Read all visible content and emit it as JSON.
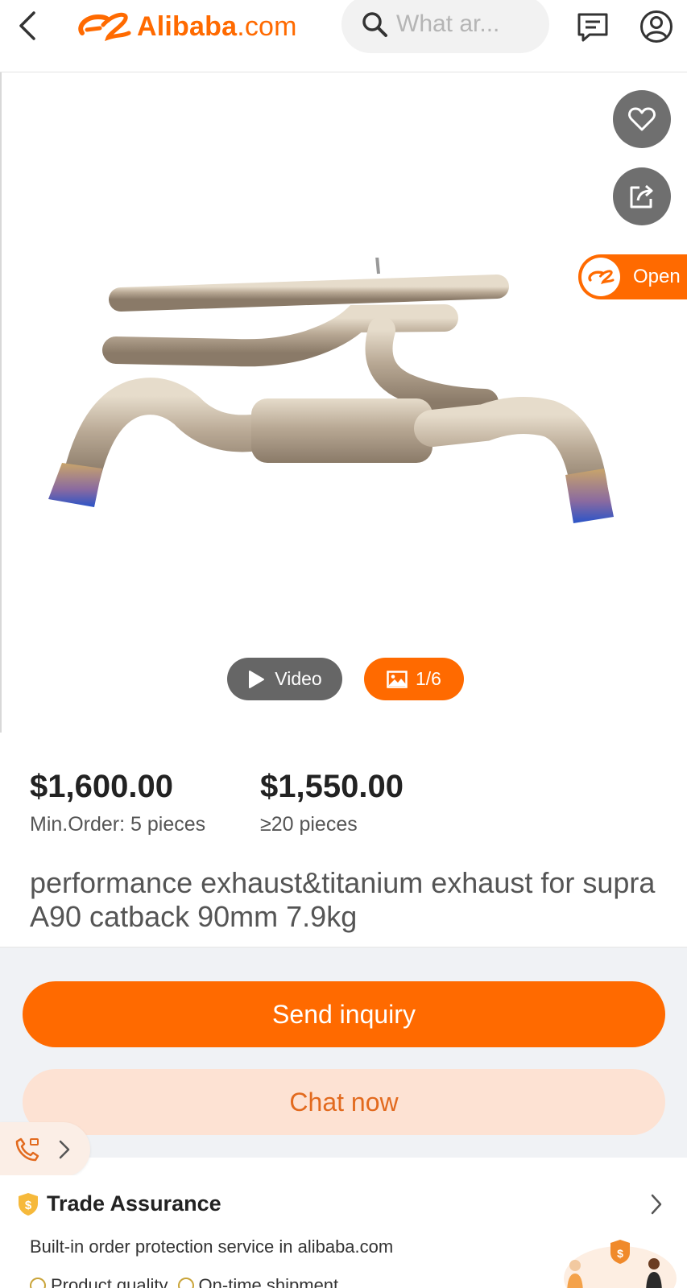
{
  "header": {
    "logo_brand": "Alibaba",
    "logo_suffix": ".com",
    "search_placeholder": "What ar...",
    "icons": [
      "chevron-left-icon",
      "search-icon",
      "message-icon",
      "user-icon"
    ]
  },
  "gallery": {
    "open_label": "Open",
    "video_label": "Video",
    "image_count": "1/6",
    "icons": [
      "heart-icon",
      "share-icon",
      "play-icon",
      "image-icon"
    ]
  },
  "pricing": {
    "tiers": [
      {
        "price": "$1,600.00",
        "condition": "Min.Order: 5 pieces"
      },
      {
        "price": "$1,550.00",
        "condition": "≥20 pieces"
      }
    ]
  },
  "product": {
    "title": "performance exhaust&titanium exhaust for supra A90 catback 90mm 7.9kg"
  },
  "actions": {
    "inquiry_label": "Send inquiry",
    "chat_label": "Chat now",
    "icons": [
      "phone-call-icon",
      "chevron-right-icon"
    ]
  },
  "trade_assurance": {
    "title": "Trade Assurance",
    "description": "Built-in order protection service in alibaba.com",
    "features": [
      "Product quality",
      "On-time shipment"
    ]
  },
  "colors": {
    "brand": "#ff6a00",
    "chat_bg": "#fde2d3",
    "overlay_btn": "#6f6f6f"
  }
}
